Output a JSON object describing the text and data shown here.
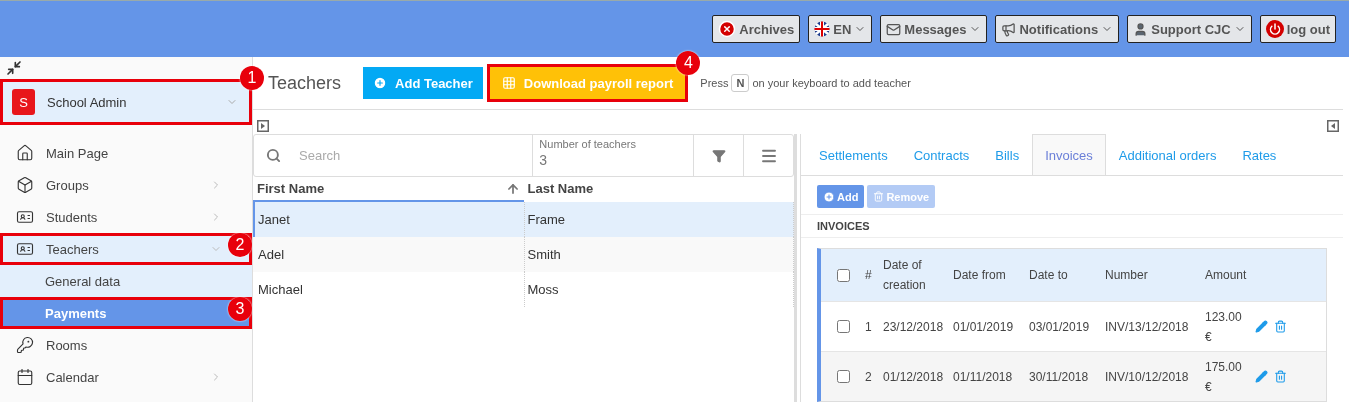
{
  "header": {
    "buttons": [
      {
        "kind": "archives",
        "label": "Archives",
        "dropdown": false
      },
      {
        "kind": "language",
        "label": "EN",
        "dropdown": true
      },
      {
        "kind": "messages",
        "label": "Messages",
        "dropdown": true
      },
      {
        "kind": "notifications",
        "label": "Notifications",
        "dropdown": true
      },
      {
        "kind": "user",
        "label": "Support CJC",
        "dropdown": true
      },
      {
        "kind": "logout",
        "label": "log out",
        "dropdown": false
      }
    ]
  },
  "sidebar": {
    "account": {
      "initial": "S",
      "name": "School Admin",
      "callout": "1"
    },
    "items": [
      {
        "kind": "home",
        "label": "Main Page",
        "expandable": false,
        "expanded": false
      },
      {
        "kind": "box",
        "label": "Groups",
        "expandable": true,
        "expanded": false
      },
      {
        "kind": "card",
        "label": "Students",
        "expandable": true,
        "expanded": false
      },
      {
        "kind": "card",
        "label": "Teachers",
        "expandable": true,
        "expanded": true,
        "callout": "2",
        "children": [
          {
            "label": "General data",
            "selected": false
          },
          {
            "label": "Payments",
            "selected": true,
            "callout": "3"
          }
        ]
      },
      {
        "kind": "key",
        "label": "Rooms",
        "expandable": false,
        "expanded": false
      },
      {
        "kind": "calendar",
        "label": "Calendar",
        "expandable": true,
        "expanded": false
      }
    ]
  },
  "toolbar": {
    "title": "Teachers",
    "add_button": "Add Teacher",
    "download_button": {
      "label": "Download payroll report",
      "callout": "4"
    },
    "hint": {
      "before": "Press",
      "key": "N",
      "after": "on your keyboard to add teacher"
    }
  },
  "teachers": {
    "search": {
      "placeholder": "Search"
    },
    "count_label": "Number of teachers",
    "count": "3",
    "columns": [
      {
        "label": "First Name",
        "sorted": true
      },
      {
        "label": "Last Name",
        "sorted": false
      }
    ],
    "rows": [
      {
        "first": "Janet",
        "last": "Frame",
        "selected": true
      },
      {
        "first": "Adel",
        "last": "Smith",
        "selected": false
      },
      {
        "first": "Michael",
        "last": "Moss",
        "selected": false
      }
    ]
  },
  "details": {
    "tabs": [
      {
        "label": "Settlements",
        "selected": false
      },
      {
        "label": "Contracts",
        "selected": false
      },
      {
        "label": "Bills",
        "selected": false
      },
      {
        "label": "Invoices",
        "selected": true
      },
      {
        "label": "Additional orders",
        "selected": false
      },
      {
        "label": "Rates",
        "selected": false
      }
    ],
    "buttons": [
      {
        "kind": "add",
        "label": "Add",
        "disabled": false
      },
      {
        "kind": "remove",
        "label": "Remove",
        "disabled": true
      }
    ],
    "section": "INVOICES",
    "columns": [
      "#",
      "Date of creation",
      "Date from",
      "Date to",
      "Number",
      "Amount"
    ],
    "all_checked": false,
    "rows": [
      {
        "checked": false,
        "cells": [
          "1",
          "23/12/2018",
          "01/01/2019",
          "03/01/2019",
          "INV/13/12/2018",
          "123.00 €"
        ]
      },
      {
        "checked": false,
        "cells": [
          "2",
          "01/12/2018",
          "01/11/2018",
          "30/11/2018",
          "INV/10/12/2018",
          "175.00 €"
        ]
      }
    ]
  }
}
